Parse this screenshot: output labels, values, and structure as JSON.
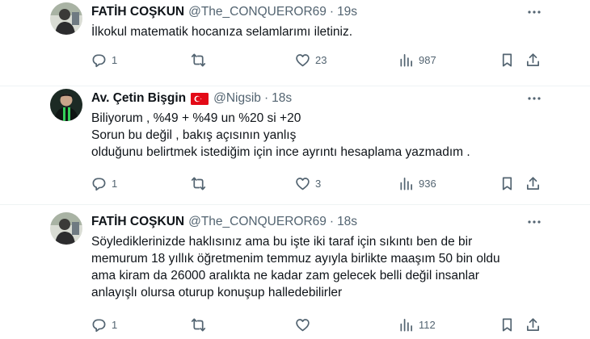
{
  "tweets": [
    {
      "name": "FATİH COŞKUN",
      "handle": "@The_CONQUEROR69",
      "separator": "·",
      "time": "19s",
      "lines": [
        "İlkokul matematik hocanıza selamlarımı iletiniz."
      ],
      "replies": "1",
      "reposts": "",
      "likes": "23",
      "views": "987"
    },
    {
      "name": "Av. Çetin Bişgin",
      "handle": "@Nigsib",
      "separator": "·",
      "time": "18s",
      "lines": [
        "Biliyorum , %49 + %49 un %20 si +20",
        "Sorun bu değil , bakış açısının yanlış",
        "olduğunu belirtmek istediğim için ince ayrıntı hesaplama yazmadım ."
      ],
      "replies": "1",
      "reposts": "",
      "likes": "3",
      "views": "936"
    },
    {
      "name": "FATİH COŞKUN",
      "handle": "@The_CONQUEROR69",
      "separator": "·",
      "time": "18s",
      "lines": [
        "Söylediklerinizde haklısınız ama bu işte iki taraf için sıkıntı ben de bir",
        "memurum 18 yıllık öğretmenim temmuz ayıyla birlikte maaşım 50 bin oldu",
        "ama kiram da 26000 aralıkta ne kadar zam gelecek belli değil insanlar",
        "anlayışlı olursa oturup konuşup halledebilirler"
      ],
      "replies": "1",
      "reposts": "",
      "likes": "",
      "views": "112"
    }
  ],
  "icons": {
    "reply": "reply-icon",
    "repost": "repost-icon",
    "like": "heart-icon",
    "views": "views-icon",
    "bookmark": "bookmark-icon",
    "share": "share-icon",
    "more": "more-icon",
    "flag": "turkey-flag-icon"
  },
  "colors": {
    "text": "#0f1419",
    "secondary": "#536471",
    "divider": "#eff3f4",
    "flag": "#e30a17"
  }
}
